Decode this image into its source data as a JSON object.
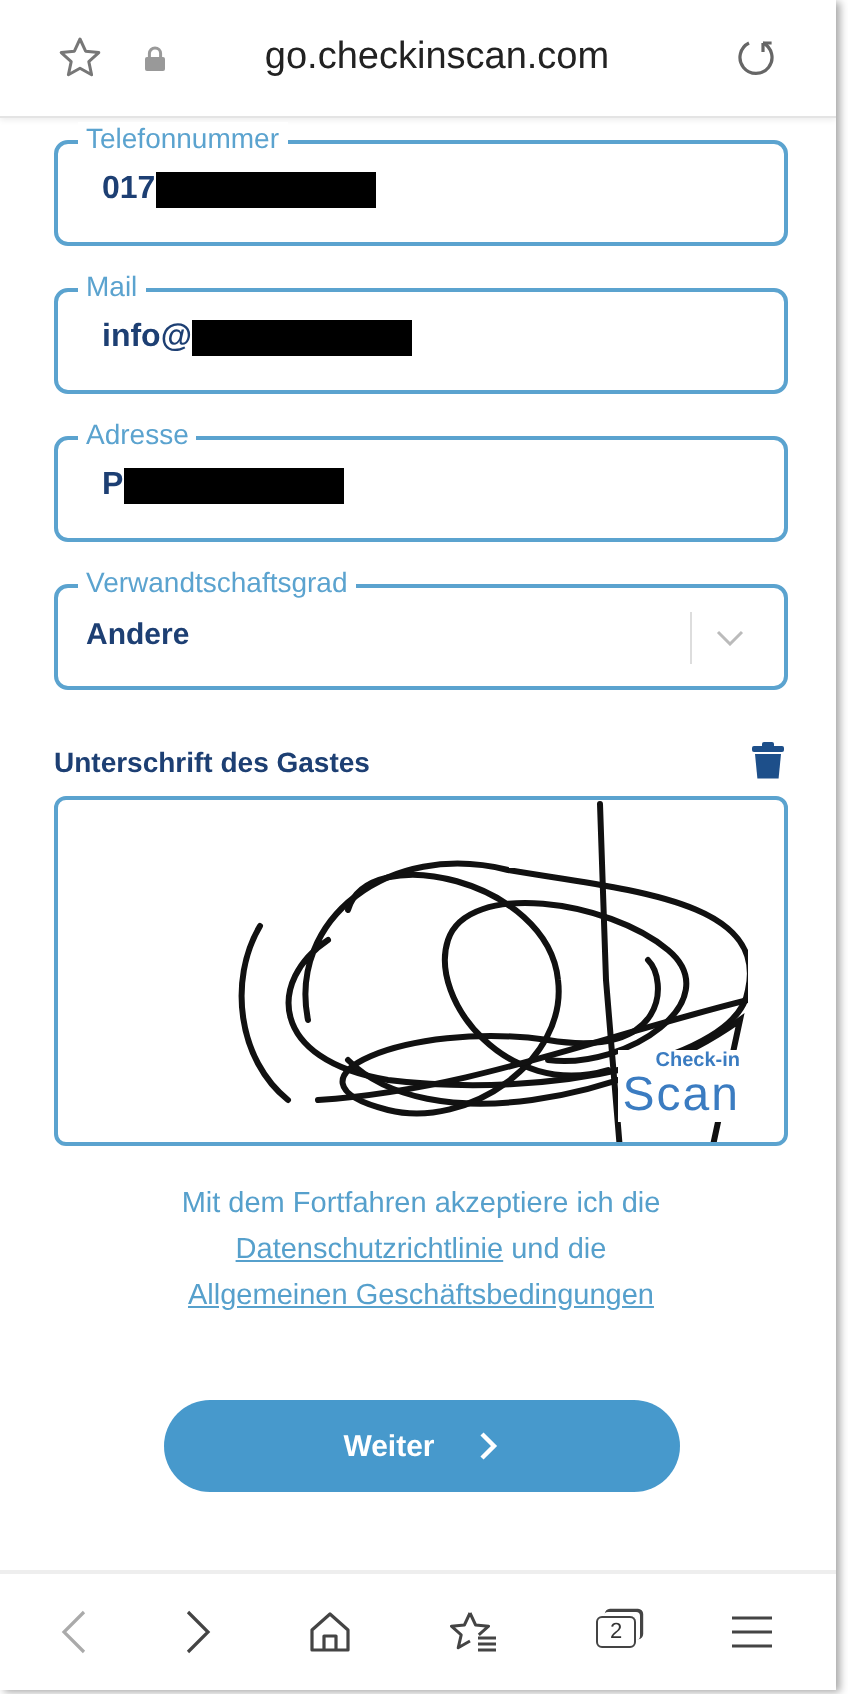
{
  "browser": {
    "url": "go.checkinscan.com"
  },
  "fields": [
    {
      "kind": "text",
      "label": "Telefonnummer",
      "value": "017",
      "redacted": true
    },
    {
      "kind": "text",
      "label": "Mail",
      "value": "info@",
      "redacted": true
    },
    {
      "kind": "text",
      "label": "Adresse",
      "value": "P",
      "redacted": true
    },
    {
      "kind": "select",
      "label": "Verwandtschaftsgrad",
      "value": "Andere",
      "redacted": false
    }
  ],
  "signature": {
    "title": "Unterschrift des Gastes",
    "logo_top": "Check-in",
    "logo_bottom": "Scan"
  },
  "consent": {
    "text": "Mit dem Fortfahren akzeptiere ich die",
    "link1": "Datenschutzrichtlinie",
    "middle": "und die",
    "link2": "Allgemeinen Geschäftsbedingungen"
  },
  "submit": {
    "label": "Weiter"
  },
  "nav": [
    {
      "kind": "back",
      "disabled": true
    },
    {
      "kind": "forward",
      "disabled": false
    },
    {
      "kind": "home",
      "disabled": false
    },
    {
      "kind": "bookmarks",
      "disabled": false
    },
    {
      "kind": "tabs",
      "disabled": false,
      "count": "2"
    },
    {
      "kind": "menu",
      "disabled": false
    }
  ]
}
